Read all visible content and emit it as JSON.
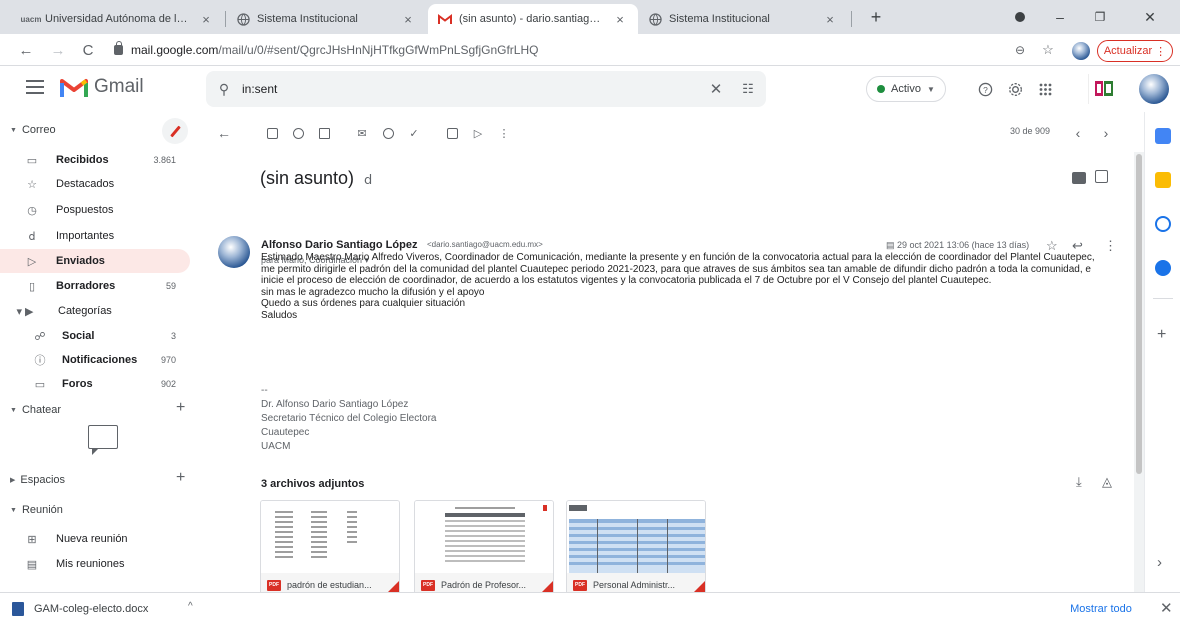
{
  "browser": {
    "tabs": [
      {
        "title": "Universidad Autónoma de la Ciu",
        "favicon": "uacm-icon",
        "active": false
      },
      {
        "title": "Sistema Institucional",
        "favicon": "globe-icon",
        "active": false
      },
      {
        "title": "(sin asunto) - dario.santiago@ua",
        "favicon": "gmail-icon",
        "active": true
      },
      {
        "title": "Sistema Institucional",
        "favicon": "globe-icon",
        "active": false
      }
    ],
    "url_host": "mail.google.com",
    "url_path": "/mail/u/0/#sent/QgrcJHsHnNjHTfkgGfWmPnLSgfjGnGfrLHQ",
    "update_label": "Actualizar"
  },
  "gmail": {
    "app_name": "Gmail",
    "search_value": "in:sent",
    "status_label": "Activo",
    "status_color": "#1e8e3e",
    "brand_color": "#d93025"
  },
  "sidebar": {
    "mail_section": "Correo",
    "items": [
      {
        "label": "Recibidos",
        "count": "3.861",
        "icon": "inbox-icon",
        "bold": true
      },
      {
        "label": "Destacados",
        "count": "",
        "icon": "star-icon",
        "bold": false
      },
      {
        "label": "Pospuestos",
        "count": "",
        "icon": "clock-icon",
        "bold": false
      },
      {
        "label": "Importantes",
        "count": "",
        "icon": "important-icon",
        "bold": false
      },
      {
        "label": "Enviados",
        "count": "",
        "icon": "send-icon",
        "bold": true,
        "selected": true
      },
      {
        "label": "Borradores",
        "count": "59",
        "icon": "draft-icon",
        "bold": true
      },
      {
        "label": "Categorías",
        "count": "",
        "icon": "label-icon",
        "bold": false
      },
      {
        "label": "Social",
        "count": "3",
        "icon": "people-icon",
        "bold": true
      },
      {
        "label": "Notificaciones",
        "count": "970",
        "icon": "info-icon",
        "bold": true
      },
      {
        "label": "Foros",
        "count": "902",
        "icon": "forum-icon",
        "bold": true
      }
    ],
    "chat_section": "Chatear",
    "spaces_section": "Espacios",
    "meet_section": "Reunión",
    "meet_items": [
      {
        "label": "Nueva reunión",
        "icon": "video-icon"
      },
      {
        "label": "Mis reuniones",
        "icon": "calendar-icon"
      }
    ]
  },
  "toolbar": {
    "pager": "30 de 909"
  },
  "message": {
    "subject": "(sin asunto)",
    "sender_name": "Alfonso Dario Santiago López",
    "sender_email": "<dario.santiago@uacm.edu.mx>",
    "recipients": "para Mario, Coordinación ▾",
    "date": "29 oct 2021 13:06 (hace 13 días)",
    "body": [
      "Estimado Maestro Mario Alfredo Viveros, Coordinador de Comunicación, mediante la presente y en función de la convocatoria actual para la elección de coordinador del Plantel Cuautepec,",
      "me permito dirigirle el padrón del la comunidad del plantel Cuautepec periodo 2021-2023, para que atraves de sus ámbitos sea tan amable de difundir dicho padrón a toda la comunidad, e",
      "inicie el proceso de elección de coordinador, de acuerdo a los estatutos vigentes y la convocatoria publicada el 7 de Octubre por el V Consejo del plantel Cuautepec.",
      "sin mas le agradezco mucho la difusión y el apoyo",
      "Quedo a sus órdenes para cualquier situación",
      "Saludos"
    ],
    "signature": [
      "--",
      "Dr. Alfonso Dario Santiago López",
      "Secretario Técnico del Colegio Electora",
      "Cuautepec",
      "UACM"
    ],
    "attachments_header": "3 archivos adjuntos",
    "attachments": [
      {
        "name": "padrón de estudian...",
        "type": "PDF"
      },
      {
        "name": "Padrón de Profesor...",
        "type": "PDF"
      },
      {
        "name": "Personal Administr...",
        "type": "PDF"
      }
    ]
  },
  "downloads": {
    "file": "GAM-coleg-electo.docx",
    "show_all": "Mostrar todo"
  }
}
